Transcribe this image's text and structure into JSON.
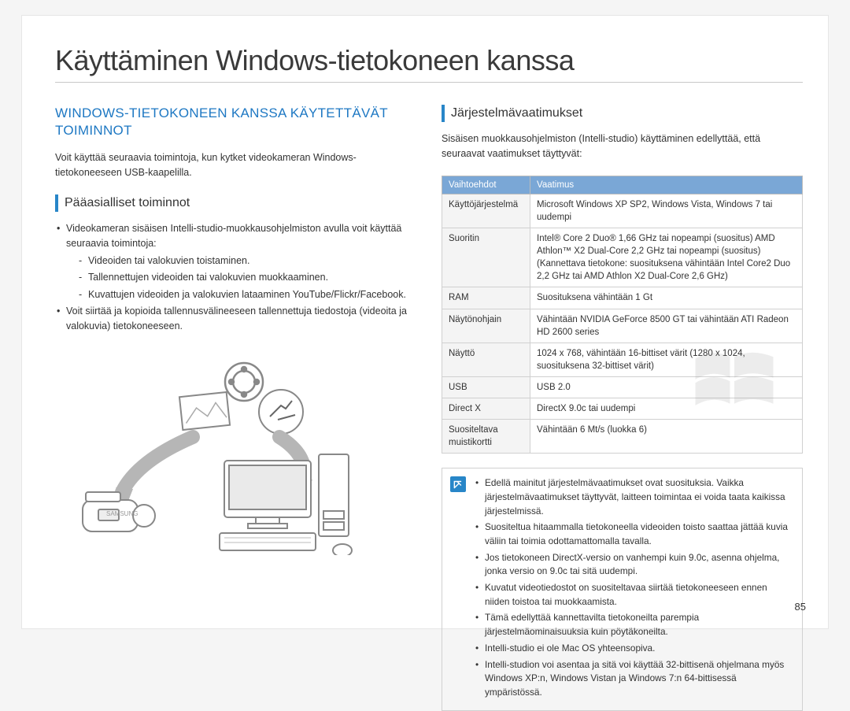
{
  "page_title": "Käyttäminen Windows-tietokoneen kanssa",
  "page_number": "85",
  "left": {
    "heading": "WINDOWS-TIETOKONEEN KANSSA KÄYTETTÄVÄT TOIMINNOT",
    "intro": "Voit käyttää seuraavia toimintoja, kun kytket videokameran Windows-tietokoneeseen USB-kaapelilla.",
    "subhead": "Pääasialliset toiminnot",
    "bullet1": "Videokameran sisäisen Intelli-studio-muokkausohjelmiston avulla voit käyttää seuraavia toimintoja:",
    "sub1": "Videoiden tai valokuvien toistaminen.",
    "sub2": "Tallennettujen videoiden tai valokuvien muokkaaminen.",
    "sub3": "Kuvattujen videoiden ja valokuvien lataaminen YouTube/Flickr/Facebook.",
    "bullet2": "Voit siirtää ja kopioida tallennusvälineeseen tallennettuja tiedostoja (videoita ja valokuvia) tietokoneeseen."
  },
  "right": {
    "subhead": "Järjestelmävaatimukset",
    "intro": "Sisäisen muokkausohjelmiston (Intelli-studio) käyttäminen edellyttää, että seuraavat vaatimukset täyttyvät:",
    "table": {
      "header_option": "Vaihtoehdot",
      "header_req": "Vaatimus",
      "rows": [
        {
          "label": "Käyttöjärjestelmä",
          "value": "Microsoft Windows XP SP2, Windows Vista, Windows 7 tai uudempi"
        },
        {
          "label": "Suoritin",
          "value": "Intel® Core 2 Duo® 1,66 GHz tai nopeampi (suositus)\nAMD Athlon™ X2 Dual-Core 2,2 GHz tai nopeampi (suositus)\n(Kannettava tietokone: suosituksena vähintään Intel Core2 Duo 2,2 GHz tai AMD Athlon X2 Dual-Core 2,6 GHz)"
        },
        {
          "label": "RAM",
          "value": "Suosituksena vähintään 1 Gt"
        },
        {
          "label": "Näytönohjain",
          "value": "Vähintään NVIDIA GeForce 8500 GT tai vähintään ATI Radeon HD 2600 series"
        },
        {
          "label": "Näyttö",
          "value": "1024 x 768, vähintään 16-bittiset värit (1280 x 1024, suosituksena 32-bittiset värit)"
        },
        {
          "label": "USB",
          "value": "USB 2.0"
        },
        {
          "label": "Direct X",
          "value": "DirectX 9.0c tai uudempi"
        },
        {
          "label": "Suositeltava muistikortti",
          "value": "Vähintään 6 Mt/s (luokka 6)"
        }
      ]
    },
    "notes": [
      "Edellä mainitut järjestelmävaatimukset ovat suosituksia. Vaikka järjestelmävaatimukset täyttyvät, laitteen toimintaa ei voida taata kaikissa järjestelmissä.",
      "Suositeltua hitaammalla tietokoneella videoiden toisto saattaa jättää kuvia väliin tai toimia odottamattomalla tavalla.",
      "Jos tietokoneen DirectX-versio on vanhempi kuin 9.0c, asenna ohjelma, jonka versio on 9.0c tai sitä uudempi.",
      "Kuvatut videotiedostot on suositeltavaa siirtää tietokoneeseen ennen niiden toistoa tai muokkaamista.",
      "Tämä edellyttää kannettavilta tietokoneilta parempia järjestelmäominaisuuksia kuin pöytäkoneilta.",
      "Intelli-studio ei ole Mac OS yhteensopiva.",
      "Intelli-studion voi asentaa ja sitä voi käyttää 32-bittisenä ohjelmana myös Windows XP:n, Windows Vistan ja Windows 7:n 64-bittisessä ympäristössä."
    ]
  }
}
